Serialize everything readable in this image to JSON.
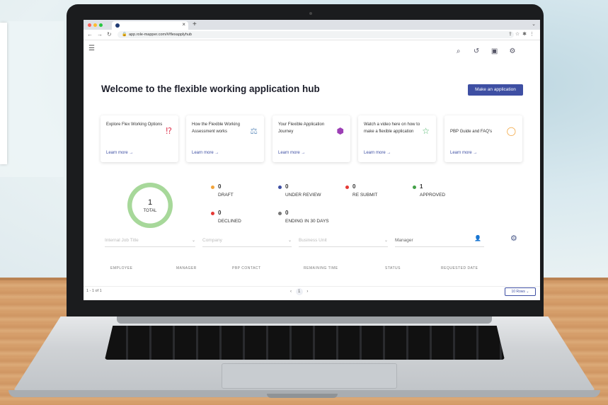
{
  "browser": {
    "tab_close": "×",
    "new_tab": "+",
    "url": "app.role-mapper.com/#/flexapplyhub"
  },
  "app": {
    "title": "Welcome to the flexible working application hub",
    "cta": "Make an application"
  },
  "cards": [
    {
      "text": "Explore Flex Working Options",
      "link": "Learn more →",
      "icon": "question-bubble-icon",
      "color": "#e0405a"
    },
    {
      "text": "How the Flexible Working Assessment works",
      "link": "Learn more →",
      "icon": "scale-icon",
      "color": "#7aa0c8"
    },
    {
      "text": "Your Flexible Application Journey",
      "link": "Learn more →",
      "icon": "cube-icon",
      "color": "#9c3fb5"
    },
    {
      "text": "Watch a video here on how to make a flexible application",
      "link": "Learn more →",
      "icon": "star-icon",
      "color": "#4db56a"
    },
    {
      "text": "PBP Guide and FAQ's",
      "link": "Learn more →",
      "icon": "chat-icon",
      "color": "#f2a33a"
    }
  ],
  "summary": {
    "total_value": "1",
    "total_label": "TOTAL",
    "stats": [
      {
        "value": "0",
        "label": "DRAFT",
        "color": "#f2a33a"
      },
      {
        "value": "0",
        "label": "UNDER REVIEW",
        "color": "#3e4fa3"
      },
      {
        "value": "0",
        "label": "RE SUBMIT",
        "color": "#e53935"
      },
      {
        "value": "1",
        "label": "APPROVED",
        "color": "#43a047"
      },
      {
        "value": "0",
        "label": "DECLINED",
        "color": "#e53935"
      },
      {
        "value": "0",
        "label": "ENDING IN 30 DAYS",
        "color": "#777777"
      }
    ]
  },
  "filters": [
    {
      "placeholder": "Internal Job Title"
    },
    {
      "placeholder": "Company"
    },
    {
      "placeholder": "Business Unit"
    },
    {
      "placeholder": "Manager"
    }
  ],
  "table": {
    "headers": [
      "EMPLOYEE",
      "MANAGER",
      "PBP CONTACT",
      "REMAINING TIME",
      "STATUS",
      "REQUESTED DATE"
    ]
  },
  "footer": {
    "count": "1 - 1 of 1",
    "page": "1",
    "rows": "10 Rows"
  }
}
